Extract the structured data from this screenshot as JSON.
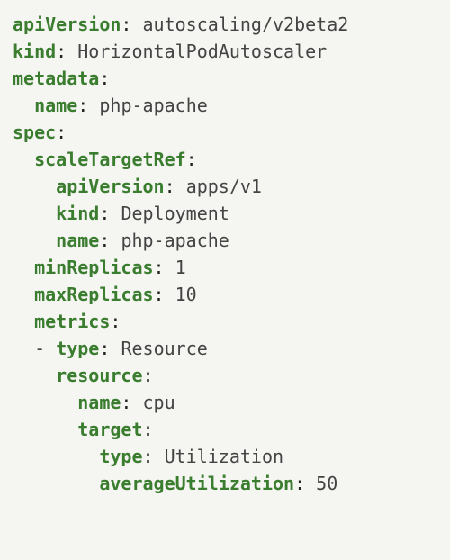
{
  "yaml": {
    "apiVersion_key": "apiVersion",
    "apiVersion_val": "autoscaling/v2beta2",
    "kind_key": "kind",
    "kind_val": "HorizontalPodAutoscaler",
    "metadata_key": "metadata",
    "metadata_name_key": "name",
    "metadata_name_val": "php-apache",
    "spec_key": "spec",
    "scaleTargetRef_key": "scaleTargetRef",
    "str_apiVersion_key": "apiVersion",
    "str_apiVersion_val": "apps/v1",
    "str_kind_key": "kind",
    "str_kind_val": "Deployment",
    "str_name_key": "name",
    "str_name_val": "php-apache",
    "minReplicas_key": "minReplicas",
    "minReplicas_val": "1",
    "maxReplicas_key": "maxReplicas",
    "maxReplicas_val": "10",
    "metrics_key": "metrics",
    "metrics_dash": "-",
    "metrics_type_key": "type",
    "metrics_type_val": "Resource",
    "resource_key": "resource",
    "resource_name_key": "name",
    "resource_name_val": "cpu",
    "target_key": "target",
    "target_type_key": "type",
    "target_type_val": "Utilization",
    "avgUtil_key": "averageUtilization",
    "avgUtil_val": "50"
  }
}
